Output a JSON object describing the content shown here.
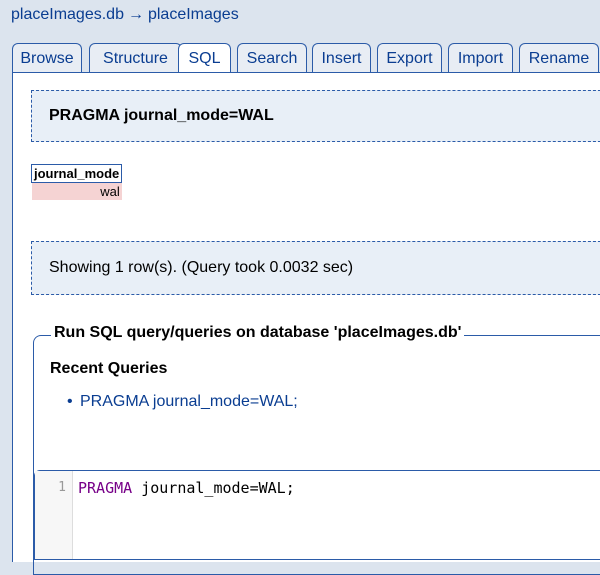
{
  "breadcrumb": {
    "database": "placeImages.db",
    "arrow": "→",
    "table": "placeImages"
  },
  "tabs": [
    {
      "label": "Browse",
      "active": false
    },
    {
      "label": "Structure",
      "active": false
    },
    {
      "label": "SQL",
      "active": true
    },
    {
      "label": "Search",
      "active": false
    },
    {
      "label": "Insert",
      "active": false
    },
    {
      "label": "Export",
      "active": false
    },
    {
      "label": "Import",
      "active": false
    },
    {
      "label": "Rename",
      "active": false
    }
  ],
  "executed_query": "PRAGMA journal_mode=WAL",
  "result": {
    "column": "journal_mode",
    "value": "wal"
  },
  "status": "Showing 1 row(s). (Query took 0.0032 sec)",
  "sql_section": {
    "legend": "Run SQL query/queries on database 'placeImages.db'",
    "recent_title": "Recent Queries",
    "recent_queries": [
      "PRAGMA journal_mode=WAL;"
    ]
  },
  "editor": {
    "line_number": "1",
    "keyword": "PRAGMA",
    "rest": " journal_mode=WAL;"
  },
  "colors": {
    "link": "#0a3d91",
    "border": "#2b5ba8",
    "background": "#dce4ee",
    "result_cell": "#f5d3d3",
    "keyword": "#770088"
  }
}
